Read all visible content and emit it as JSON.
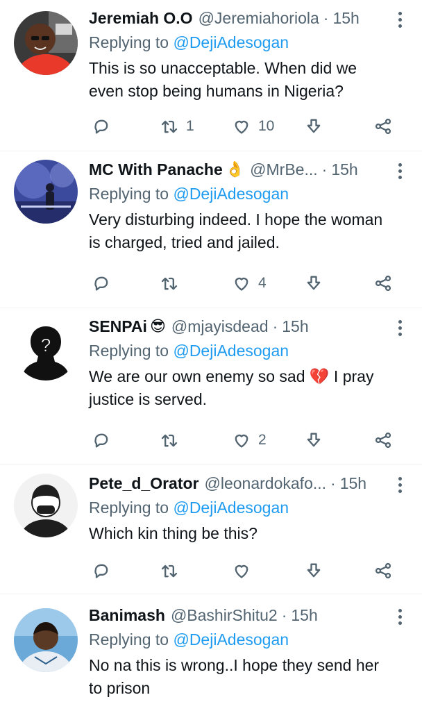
{
  "colors": {
    "name": "#0f1419",
    "muted": "#536471",
    "accent": "#1d9bf0",
    "divider": "#eff3f4"
  },
  "replying_label": "Replying to",
  "icons": {
    "reply": "reply-icon",
    "retweet": "retweet-icon",
    "like": "like-icon",
    "download": "download-icon",
    "share": "share-icon",
    "more": "more-options-icon"
  },
  "tweets": [
    {
      "name": "Jeremiah O.O",
      "emoji": "",
      "handle": "@Jeremiahoriola",
      "time": "15h",
      "mention": "@DejiAdesogan",
      "text": "This is so unacceptable. When did we even stop being humans in Nigeria?",
      "retweets": "1",
      "likes": "10"
    },
    {
      "name": "MC With Panache",
      "emoji": "👌",
      "handle": "@MrBe...",
      "time": "15h",
      "mention": "@DejiAdesogan",
      "text": "Very disturbing indeed. I hope the woman is charged, tried and jailed.",
      "retweets": "",
      "likes": "4"
    },
    {
      "name": "SENPAi",
      "emoji": "😎",
      "handle": "@mjayisdead",
      "time": "15h",
      "mention": "@DejiAdesogan",
      "text": "We are our own enemy so sad 💔 I pray justice is served.",
      "retweets": "",
      "likes": "2"
    },
    {
      "name": "Pete_d_Orator",
      "emoji": "",
      "handle": "@leonardokafo...",
      "time": "15h",
      "mention": "@DejiAdesogan",
      "text": "Which kin thing be this?",
      "retweets": "",
      "likes": ""
    },
    {
      "name": "Banimash",
      "emoji": "",
      "handle": "@BashirShitu2",
      "time": "15h",
      "mention": "@DejiAdesogan",
      "text": "No na this is wrong..I hope they send her to prison",
      "retweets": "",
      "likes": ""
    }
  ]
}
